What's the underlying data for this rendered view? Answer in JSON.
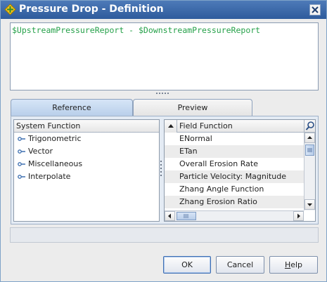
{
  "window": {
    "title": "Pressure Drop - Definition"
  },
  "expression": {
    "text": "$UpstreamPressureReport - $DownstreamPressureReport",
    "text_color": "#26a14a"
  },
  "tabs": [
    {
      "label": "Reference",
      "selected": true
    },
    {
      "label": "Preview",
      "selected": false
    }
  ],
  "system_functions": {
    "header": "System Function",
    "items": [
      {
        "label": "Trigonometric",
        "icon": "tree-node-icon"
      },
      {
        "label": "Vector",
        "icon": "tree-node-icon"
      },
      {
        "label": "Miscellaneous",
        "icon": "tree-node-icon"
      },
      {
        "label": "Interpolate",
        "icon": "tree-node-icon"
      }
    ]
  },
  "field_functions": {
    "header": "Field Function",
    "sort_icon": "sort-up-icon",
    "search_icon": "magnifier-icon",
    "items": [
      "ENormal",
      "ETan",
      "Overall Erosion Rate",
      "Particle Velocity: Magnitude",
      "Zhang Angle Function",
      "Zhang Erosion Ratio"
    ]
  },
  "buttons": {
    "ok": "OK",
    "cancel": "Cancel",
    "help_first": "H",
    "help_rest": "elp"
  },
  "colors": {
    "title_bar": "#3a67a8",
    "selected_tab": "#c7daf1"
  }
}
